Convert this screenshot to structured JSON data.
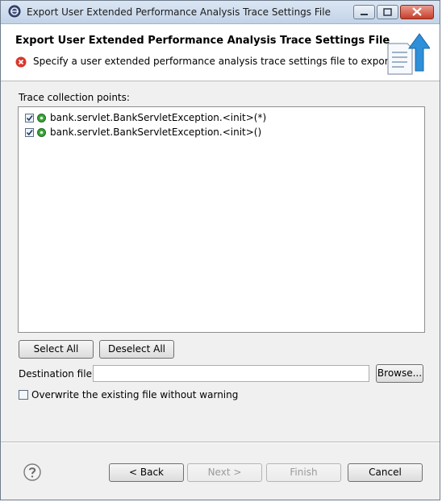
{
  "window": {
    "title": "Export User Extended Performance Analysis Trace Settings File"
  },
  "header": {
    "title": "Export User Extended Performance Analysis Trace Settings File",
    "message": "Specify a user extended performance analysis trace settings file to export."
  },
  "trace": {
    "label": "Trace collection points:",
    "items": [
      {
        "text": "bank.servlet.BankServletException.<init>(*)",
        "checked": true
      },
      {
        "text": "bank.servlet.BankServletException.<init>()",
        "checked": true
      }
    ]
  },
  "buttons": {
    "select_all": "Select All",
    "deselect_all": "Deselect All",
    "browse": "Browse...",
    "back": "< Back",
    "next": "Next >",
    "finish": "Finish",
    "cancel": "Cancel"
  },
  "destination": {
    "label": "Destination file:",
    "value": ""
  },
  "overwrite": {
    "label": "Overwrite the existing file without warning",
    "checked": false
  },
  "icons": {
    "app": "eclipse-icon",
    "error": "error-icon",
    "wizard": "export-wizard-icon",
    "item": "green-dot-icon",
    "help": "help-icon"
  },
  "colors": {
    "error": "#d9372b",
    "item_dot": "#3aa23a",
    "wizard_arrow": "#2f8fd8"
  }
}
